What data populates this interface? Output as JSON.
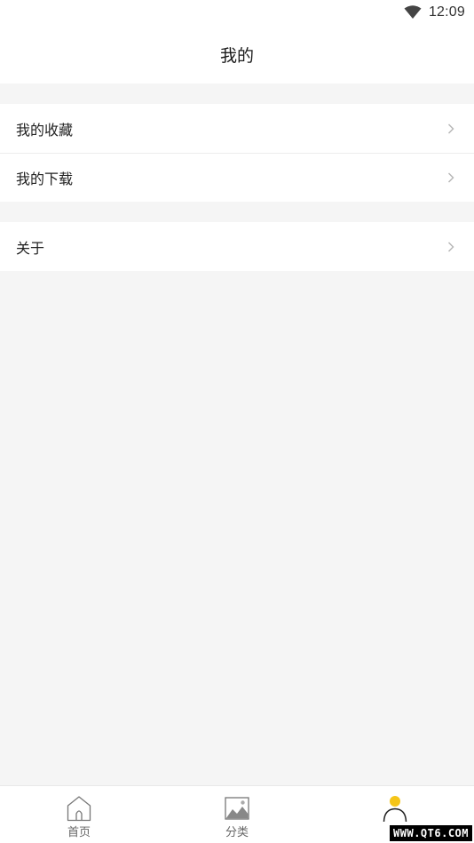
{
  "status_bar": {
    "time": "12:09",
    "wifi_icon": "wifi-icon"
  },
  "header": {
    "title": "我的"
  },
  "menu": {
    "group1": [
      {
        "label": "我的收藏",
        "icon": "chevron-right-icon"
      },
      {
        "label": "我的下载",
        "icon": "chevron-right-icon"
      }
    ],
    "group2": [
      {
        "label": "关于",
        "icon": "chevron-right-icon"
      }
    ]
  },
  "bottom_nav": {
    "active_color": "#F5C518",
    "tabs": [
      {
        "label": "首页",
        "icon": "home-icon"
      },
      {
        "label": "分类",
        "icon": "image-icon"
      },
      {
        "label": "",
        "icon": "profile-icon",
        "active": true
      }
    ]
  },
  "watermark": "WWW.QT6.COM"
}
